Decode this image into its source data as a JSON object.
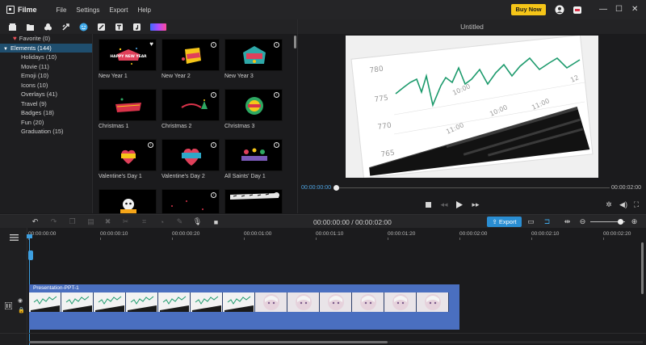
{
  "app": {
    "name": "Filme",
    "menu": [
      "File",
      "Settings",
      "Export",
      "Help"
    ],
    "buy_now": "Buy Now"
  },
  "library_tabs": [
    "media-icon",
    "folder-icon",
    "effects-icon",
    "transitions-icon",
    "elements-icon",
    "filters-icon",
    "text-icon",
    "music-icon",
    "color-icon"
  ],
  "tree": [
    {
      "label": "Favorite (0)",
      "type": "favorite"
    },
    {
      "label": "Elements (144)",
      "type": "parent",
      "selected": true
    },
    {
      "label": "Holidays (10)"
    },
    {
      "label": "Movie (11)"
    },
    {
      "label": "Emoji (10)"
    },
    {
      "label": "Icons (10)"
    },
    {
      "label": "Overlays (41)"
    },
    {
      "label": "Travel (9)"
    },
    {
      "label": "Badges (18)"
    },
    {
      "label": "Fun (20)"
    },
    {
      "label": "Graduation (15)"
    }
  ],
  "elements": [
    {
      "name": "New Year 1",
      "favorite": true
    },
    {
      "name": "New Year 2"
    },
    {
      "name": "New Year 3"
    },
    {
      "name": "Christmas 1"
    },
    {
      "name": "Christmas 2"
    },
    {
      "name": "Christmas 3"
    },
    {
      "name": "Valentine's Day 1"
    },
    {
      "name": "Valentine's Day 2"
    },
    {
      "name": "All Saints' Day 1"
    },
    {
      "name": ""
    },
    {
      "name": ""
    },
    {
      "name": ""
    }
  ],
  "preview": {
    "title": "Untitled",
    "current_time": "00:00:00:00",
    "total_time": "00:00:02:00",
    "chart_labels": [
      "780",
      "775",
      "770",
      "765",
      "11:00",
      "10:00",
      "10:00",
      "11:00",
      "12"
    ]
  },
  "timeline": {
    "time_display": "00:00:00:00 / 00:00:02:00",
    "export_label": "Export",
    "ruler": [
      "00:00:00:00",
      "00:00:00:10",
      "00:00:00:20",
      "00:00:01:00",
      "00:00:01:10",
      "00:00:01:20",
      "00:00:02:00",
      "00:00:02:10",
      "00:00:02:20"
    ],
    "clip": {
      "label": "Presentation-PPT-1",
      "chart_frames": 7,
      "face_frames": 6
    }
  }
}
